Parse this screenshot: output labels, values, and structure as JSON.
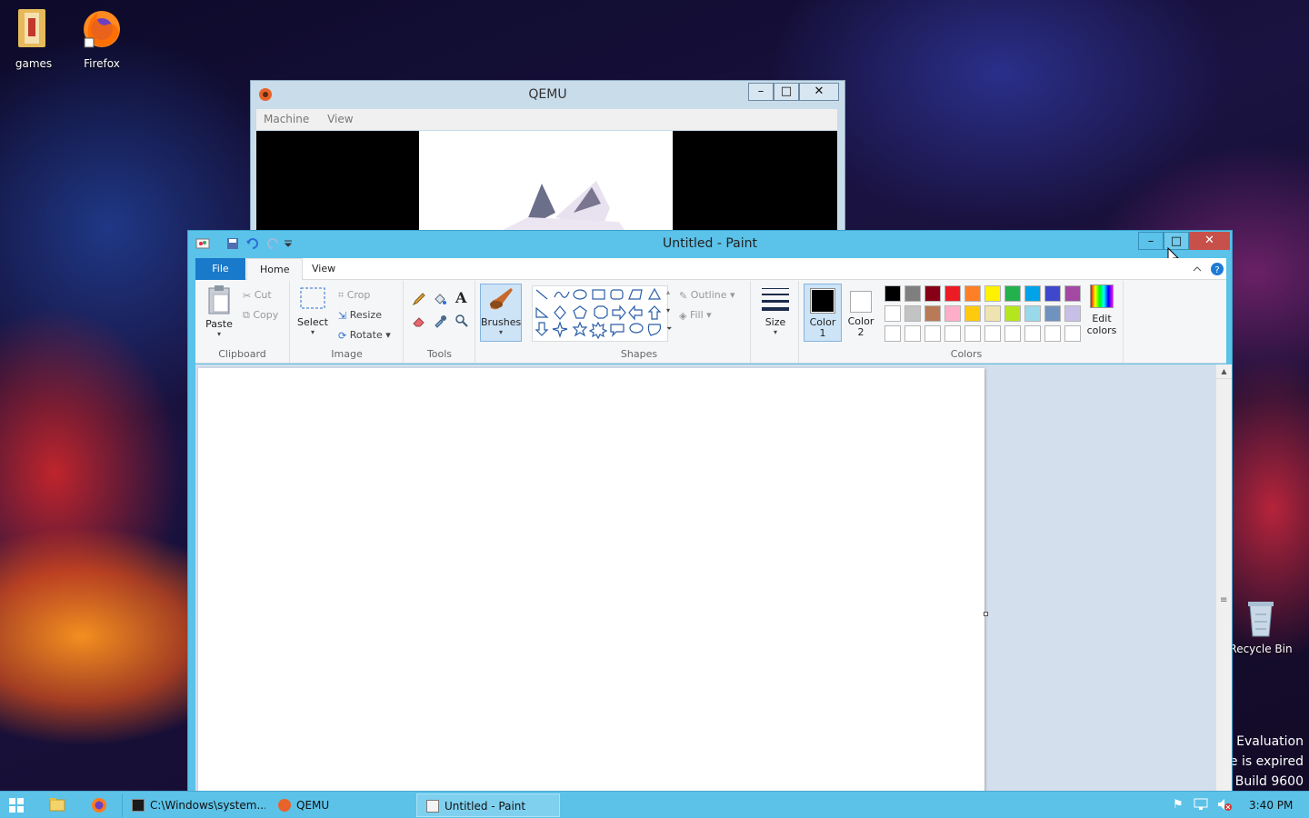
{
  "desktop": {
    "icons": [
      {
        "label": "games",
        "icon": "folder-icon"
      },
      {
        "label": "Firefox",
        "icon": "firefox-icon"
      },
      {
        "label": "Recycle Bin",
        "icon": "recycle-bin-icon"
      }
    ],
    "watermark": {
      "line1": "l Evaluation",
      "line2": "e is expired",
      "line3": "Build 9600"
    }
  },
  "qemu": {
    "title": "QEMU",
    "menu": [
      "Machine",
      "View"
    ],
    "buttons": {
      "minimize": "–",
      "maximize": "□",
      "close": "✕"
    }
  },
  "paint": {
    "title": "Untitled - Paint",
    "buttons": {
      "minimize": "–",
      "maximize": "□",
      "close": "✕"
    },
    "tabs": {
      "file": "File",
      "home": "Home",
      "view": "View"
    },
    "clipboard": {
      "paste": "Paste",
      "cut": "Cut",
      "copy": "Copy",
      "group": "Clipboard"
    },
    "image": {
      "select": "Select",
      "crop": "Crop",
      "resize": "Resize",
      "rotate": "Rotate",
      "group": "Image"
    },
    "tools": {
      "group": "Tools"
    },
    "brushes": {
      "label": "Brushes"
    },
    "shapes": {
      "outline": "Outline",
      "fill": "Fill",
      "group": "Shapes"
    },
    "size": {
      "label": "Size"
    },
    "color1": {
      "line1": "Color",
      "line2": "1"
    },
    "color2": {
      "line1": "Color",
      "line2": "2"
    },
    "colors": {
      "group": "Colors",
      "edit1": "Edit",
      "edit2": "colors",
      "row1": [
        "#000000",
        "#7f7f7f",
        "#880015",
        "#ed1c24",
        "#ff7f27",
        "#fff200",
        "#22b14c",
        "#00a2e8",
        "#3f48cc",
        "#a349a4"
      ],
      "row2": [
        "#ffffff",
        "#c3c3c3",
        "#b97a57",
        "#ffaec9",
        "#ffc90e",
        "#efe4b0",
        "#b5e61d",
        "#99d9ea",
        "#7092be",
        "#c8bfe7"
      ],
      "row3": [
        "#ffffff",
        "#ffffff",
        "#ffffff",
        "#ffffff",
        "#ffffff",
        "#ffffff",
        "#ffffff",
        "#ffffff",
        "#ffffff",
        "#ffffff"
      ]
    }
  },
  "taskbar": {
    "items": [
      {
        "label": "C:\\Windows\\system..."
      },
      {
        "label": "QEMU"
      },
      {
        "label": "Untitled - Paint"
      }
    ],
    "clock": "3:40 PM"
  }
}
